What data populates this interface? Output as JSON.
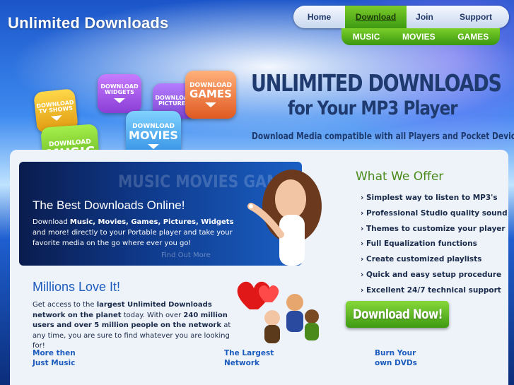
{
  "site": {
    "title": "Unlimited Downloads"
  },
  "nav": {
    "items": [
      "Home",
      "Download",
      "Join",
      "Support"
    ],
    "sub": [
      "MUSIC",
      "MOVIES",
      "GAMES"
    ]
  },
  "hero": {
    "line1": "UNLIMITED DOWNLOADS",
    "line2": "for Your MP3 Player",
    "line3": "Download Media compatible with all Players and Pocket Devices",
    "boxes": {
      "tvshows": {
        "small": "DOWNLOAD",
        "big": "TV SHOWS"
      },
      "widgets": {
        "small": "DOWNLOAD",
        "big": "WIDGETS"
      },
      "pictures": {
        "small": "DOWNLOAD",
        "big": "PICTURES"
      },
      "games": {
        "small": "DOWNLOAD",
        "big": "GAMES"
      },
      "music": {
        "small": "DOWNLOAD",
        "big": "MUSIC"
      },
      "movies": {
        "small": "DOWNLOAD",
        "big": "MOVIES"
      }
    }
  },
  "feature": {
    "watermark": "MUSIC MOVIES GAMES",
    "heading": "The Best Downloads Online!",
    "text_pre": "Download ",
    "text_bold": "Music, Movies, Games, Pictures, Widgets",
    "text_post": " and more! directly to your Portable player and take your favorite media on the go where ever you go!",
    "find_more": "Find Out More"
  },
  "offer": {
    "title": "What We Offer",
    "items": [
      "Simplest way to listen to MP3's",
      "Professional Studio quality sound",
      "Themes to customize your player",
      "Full Equalization functions",
      "Create customized playlists",
      "Quick and easy setup procedure",
      "Excellent 24/7 technical support"
    ],
    "button": "Download Now!"
  },
  "millions": {
    "title": "Millions Love It!",
    "t1": "Get access to the ",
    "b1": "largest Unlimited Downloads network on the planet",
    "t2": " today. With over ",
    "b2": "240 million users and over 5 million people on the network",
    "t3": " at any time, you are sure to find whatever you are looking for!"
  },
  "links": {
    "l1a": "More then",
    "l1b": "Just Music",
    "l2a": "The Largest",
    "l2b": "Network",
    "l3a": "Burn Your",
    "l3b": "own DVDs"
  },
  "colors": {
    "accent_green": "#5cb81e",
    "link_blue": "#1c5cbd",
    "title_navy": "#1e3a6e"
  }
}
